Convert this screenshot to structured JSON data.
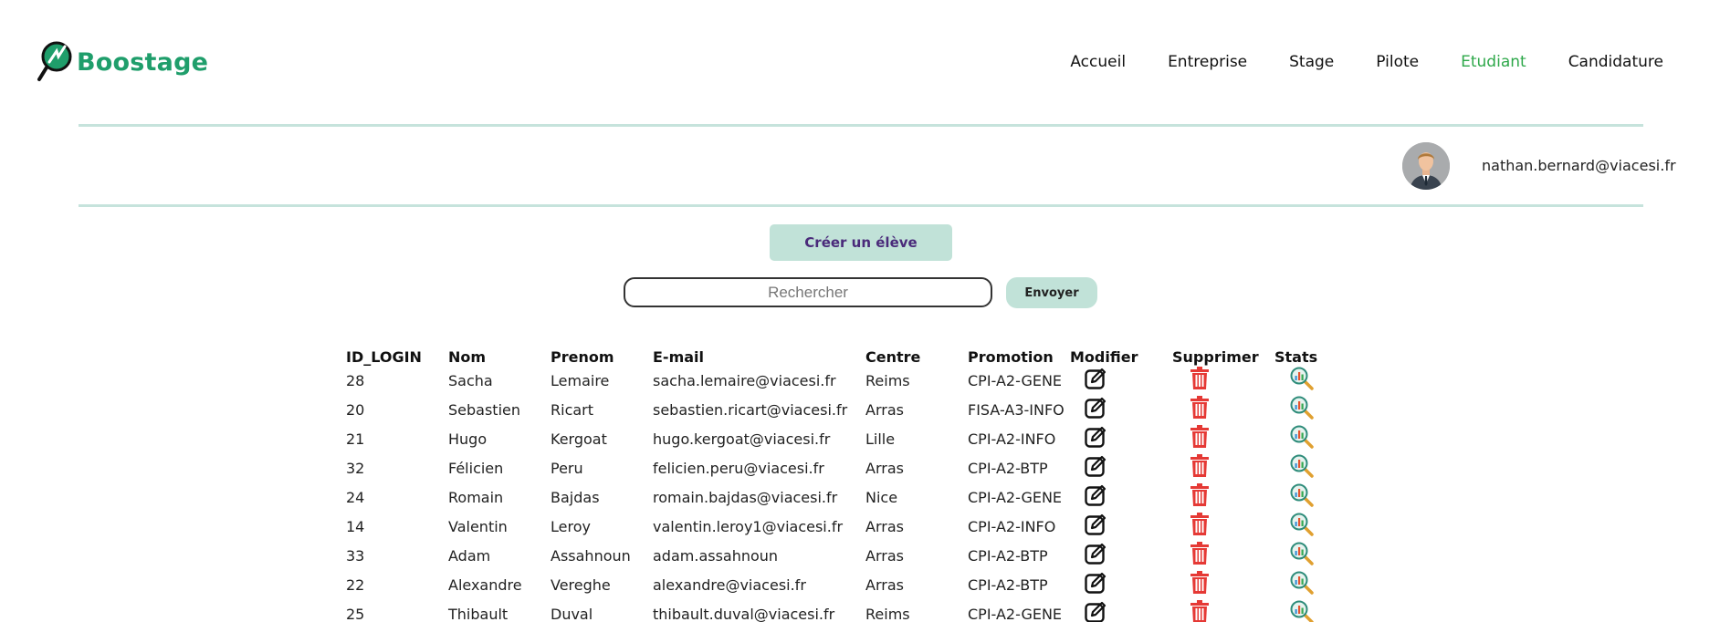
{
  "brand": {
    "name": "Boostage",
    "color": "#1f9e6b"
  },
  "nav": [
    {
      "label": "Accueil",
      "active": false
    },
    {
      "label": "Entreprise",
      "active": false
    },
    {
      "label": "Stage",
      "active": false
    },
    {
      "label": "Pilote",
      "active": false
    },
    {
      "label": "Etudiant",
      "active": true
    },
    {
      "label": "Candidature",
      "active": false
    }
  ],
  "user": {
    "email": "nathan.bernard@viacesi.fr",
    "avatar_icon": "user-avatar-icon",
    "logout_icon": "logout-icon"
  },
  "actions": {
    "create_label": "Créer un élève"
  },
  "search": {
    "placeholder": "Rechercher",
    "value": "",
    "submit_label": "Envoyer"
  },
  "table": {
    "headers": [
      "ID_LOGIN",
      "Nom",
      "Prenom",
      "E-mail",
      "Centre",
      "Promotion",
      "Modifier",
      "Supprimer",
      "Stats"
    ],
    "rows": [
      {
        "id": "28",
        "nom": "Sacha",
        "prenom": "Lemaire",
        "email": "sacha.lemaire@viacesi.fr",
        "centre": "Reims",
        "promotion": "CPI-A2-GENE"
      },
      {
        "id": "20",
        "nom": "Sebastien",
        "prenom": "Ricart",
        "email": "sebastien.ricart@viacesi.fr",
        "centre": "Arras",
        "promotion": "FISA-A3-INFO"
      },
      {
        "id": "21",
        "nom": "Hugo",
        "prenom": "Kergoat",
        "email": "hugo.kergoat@viacesi.fr",
        "centre": "Lille",
        "promotion": "CPI-A2-INFO"
      },
      {
        "id": "32",
        "nom": "Félicien",
        "prenom": "Peru",
        "email": "felicien.peru@viacesi.fr",
        "centre": "Arras",
        "promotion": "CPI-A2-BTP"
      },
      {
        "id": "24",
        "nom": "Romain",
        "prenom": "Bajdas",
        "email": "romain.bajdas@viacesi.fr",
        "centre": "Nice",
        "promotion": "CPI-A2-GENE"
      },
      {
        "id": "14",
        "nom": "Valentin",
        "prenom": "Leroy",
        "email": "valentin.leroy1@viacesi.fr",
        "centre": "Arras",
        "promotion": "CPI-A2-INFO"
      },
      {
        "id": "33",
        "nom": "Adam",
        "prenom": "Assahnoun",
        "email": "adam.assahnoun",
        "centre": "Arras",
        "promotion": "CPI-A2-BTP"
      },
      {
        "id": "22",
        "nom": "Alexandre",
        "prenom": "Vereghe",
        "email": "alexandre@viacesi.fr",
        "centre": "Arras",
        "promotion": "CPI-A2-BTP"
      },
      {
        "id": "25",
        "nom": "Thibault",
        "prenom": "Duval",
        "email": "thibault.duval@viacesi.fr",
        "centre": "Reims",
        "promotion": "CPI-A2-GENE"
      }
    ],
    "row_icons": {
      "modify": "edit-icon",
      "delete": "trash-icon",
      "stats": "stats-search-icon"
    }
  },
  "colors": {
    "accent_green": "#2ea84a",
    "button_bg": "#c1e2d8",
    "divider": "#c6e3dc",
    "delete_red": "#e53935",
    "create_text": "#4a2a7a"
  }
}
